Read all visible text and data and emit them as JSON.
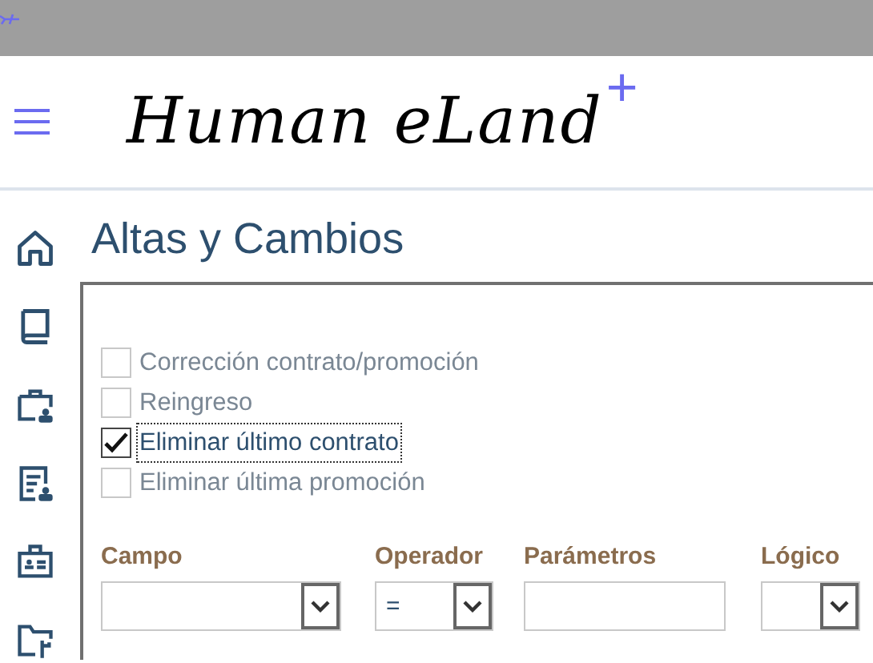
{
  "logo": {
    "name": "Human eLand",
    "mark": "+"
  },
  "sidebar": {
    "items": [
      {
        "kind": "home"
      },
      {
        "kind": "book"
      },
      {
        "kind": "briefcase"
      },
      {
        "kind": "document"
      },
      {
        "kind": "badge"
      },
      {
        "kind": "folder"
      }
    ]
  },
  "page": {
    "title": "Altas y Cambios"
  },
  "options": [
    {
      "label": "Corrección contrato/promoción",
      "checked": false,
      "focused": false
    },
    {
      "label": "Reingreso",
      "checked": false,
      "focused": false
    },
    {
      "label": "Eliminar último contrato",
      "checked": true,
      "focused": true
    },
    {
      "label": "Eliminar última promoción",
      "checked": false,
      "focused": false
    }
  ],
  "filters": [
    {
      "label": "Campo",
      "kind": "select"
    },
    {
      "label": "Operador",
      "kind": "select",
      "value": "="
    },
    {
      "label": "Parámetros",
      "kind": "input"
    },
    {
      "label": "Lógico",
      "kind": "select"
    }
  ]
}
